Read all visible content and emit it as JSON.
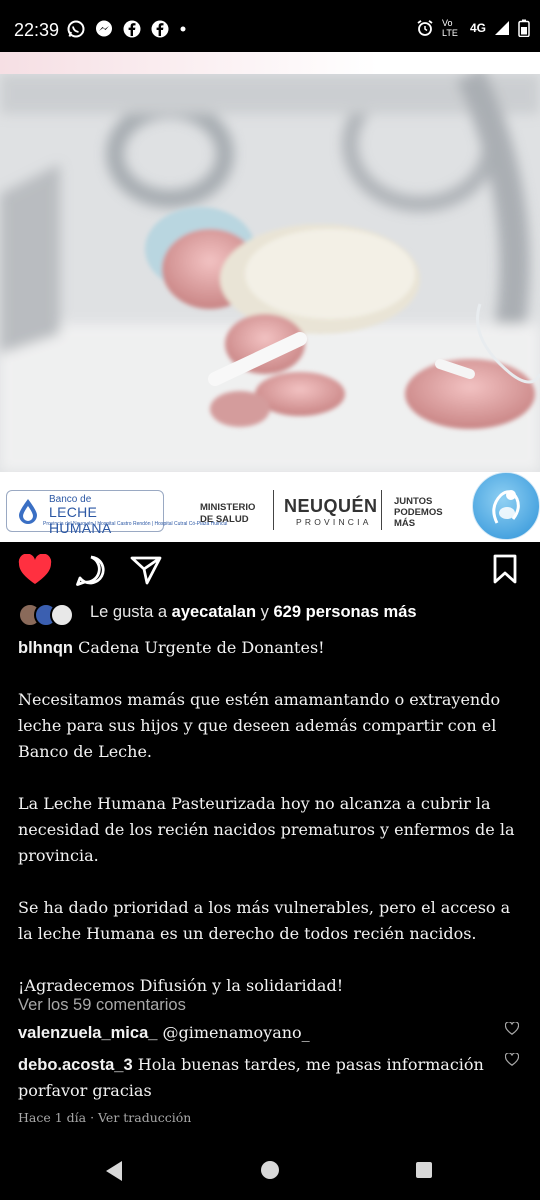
{
  "status_bar": {
    "time": "22:39",
    "network_label": "Vo LTE",
    "signal_label": "4G",
    "apps": [
      "whatsapp-icon",
      "messenger-icon",
      "facebook-icon",
      "facebook-icon"
    ]
  },
  "post_image": {
    "bank_line1": "Banco de",
    "bank_line2": "LECHE HUMANA",
    "bank_line3": "Provincia del Neuquén | Hospital Castro Rendón | Hospital Cutral Có-Plaza Huincul",
    "ministry": "MINISTERIO DE SALUD",
    "province_name": "NEUQUÉN",
    "province_word": "PROVINCIA",
    "slogan": "JUNTOS PODEMOS MÁS"
  },
  "actions": {
    "like_icon": "heart-filled-icon",
    "comment_icon": "comment-icon",
    "share_icon": "send-icon",
    "save_icon": "bookmark-icon",
    "like_color": "#ff3040"
  },
  "likes": {
    "prefix": "Le gusta a",
    "user": "ayecatalan",
    "connector": "y",
    "others": "629 personas más"
  },
  "caption": {
    "username": "blhnqn",
    "title": "Cadena Urgente de Donantes!",
    "paragraphs": [
      "Necesitamos mamás que estén amamantando o extrayendo leche para sus hijos y que deseen además compartir con el Banco de Leche.",
      "La Leche Humana Pasteurizada hoy no alcanza a cubrir la necesidad de los recién nacidos prematuros y enfermos de la provincia.",
      "Se ha dado prioridad a los más vulnerables, pero el acceso a la leche Humana es un derecho de todos recién nacidos.",
      "¡Agradecemos Difusión y la solidaridad!"
    ]
  },
  "view_comments": "Ver los 59 comentarios",
  "comments": [
    {
      "user": "valenzuela_mica_",
      "text": "@gimenamoyano_"
    },
    {
      "user": "debo.acosta_3",
      "text": "Hola buenas tardes, me pasas información porfavor gracias"
    }
  ],
  "meta": {
    "time_ago": "Hace 1 día",
    "translate": "Ver traducción"
  },
  "nav": {
    "back": "back-triangle-icon",
    "home": "home-circle-icon",
    "recents": "recents-square-icon"
  }
}
